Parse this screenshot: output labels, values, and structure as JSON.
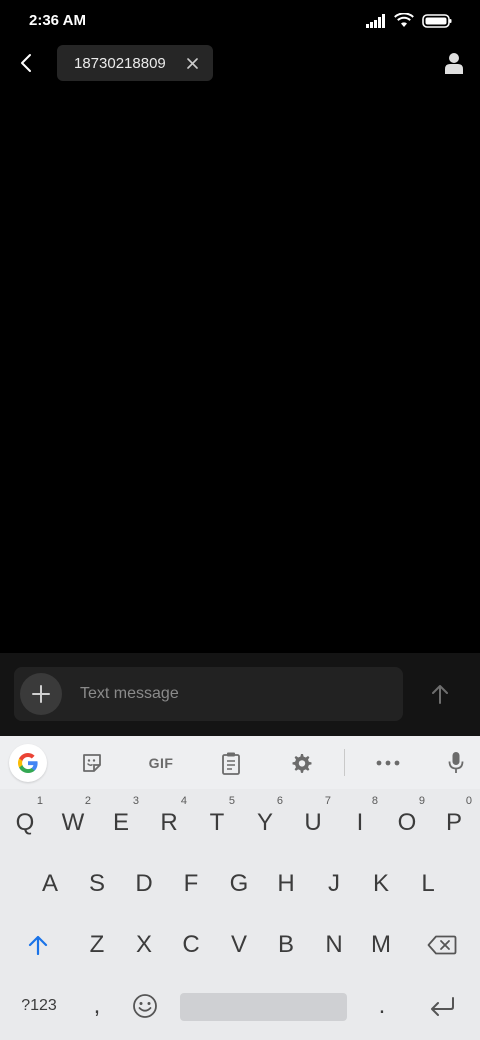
{
  "status": {
    "time": "2:36 AM"
  },
  "header": {
    "recipient": "18730218809"
  },
  "compose": {
    "placeholder": "Text message"
  },
  "keyboard": {
    "toolbar": {
      "gif_label": "GIF"
    },
    "row1": [
      {
        "label": "Q",
        "hint": "1"
      },
      {
        "label": "W",
        "hint": "2"
      },
      {
        "label": "E",
        "hint": "3"
      },
      {
        "label": "R",
        "hint": "4"
      },
      {
        "label": "T",
        "hint": "5"
      },
      {
        "label": "Y",
        "hint": "6"
      },
      {
        "label": "U",
        "hint": "7"
      },
      {
        "label": "I",
        "hint": "8"
      },
      {
        "label": "O",
        "hint": "9"
      },
      {
        "label": "P",
        "hint": "0"
      }
    ],
    "row2": [
      "A",
      "S",
      "D",
      "F",
      "G",
      "H",
      "J",
      "K",
      "L"
    ],
    "row3": [
      "Z",
      "X",
      "C",
      "V",
      "B",
      "N",
      "M"
    ],
    "row4": {
      "symbols": "?123",
      "comma": ",",
      "period": "."
    }
  },
  "colors": {
    "accent": "#1a73e8",
    "background": "#000000",
    "keyboard_bg": "#e9eaec"
  }
}
